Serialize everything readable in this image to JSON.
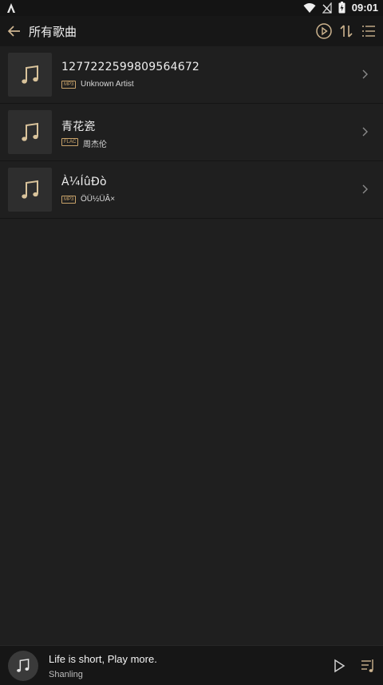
{
  "status_bar": {
    "time": "09:01"
  },
  "header": {
    "title": "所有歌曲"
  },
  "songs": [
    {
      "title": "1277222599809564672",
      "format": "MP3",
      "artist": "Unknown Artist"
    },
    {
      "title": "青花瓷",
      "format": "FLAC",
      "artist": "周杰伦"
    },
    {
      "title": "À¼ÍûÐò",
      "format": "MP3",
      "artist": "ÖÜ½ÜÂ×"
    }
  ],
  "player": {
    "title": "Life is short, Play more.",
    "artist": "Shanling"
  },
  "colors": {
    "accent": "#c9a36a",
    "background": "#1f1f1f",
    "header": "#171717"
  },
  "icons": [
    "android-icon",
    "wifi-icon",
    "no-signal-icon",
    "battery-icon",
    "back-arrow-icon",
    "play-circle-icon",
    "sort-icon",
    "list-menu-icon",
    "music-note-icon",
    "chevron-right-icon",
    "play-icon",
    "playlist-icon"
  ]
}
